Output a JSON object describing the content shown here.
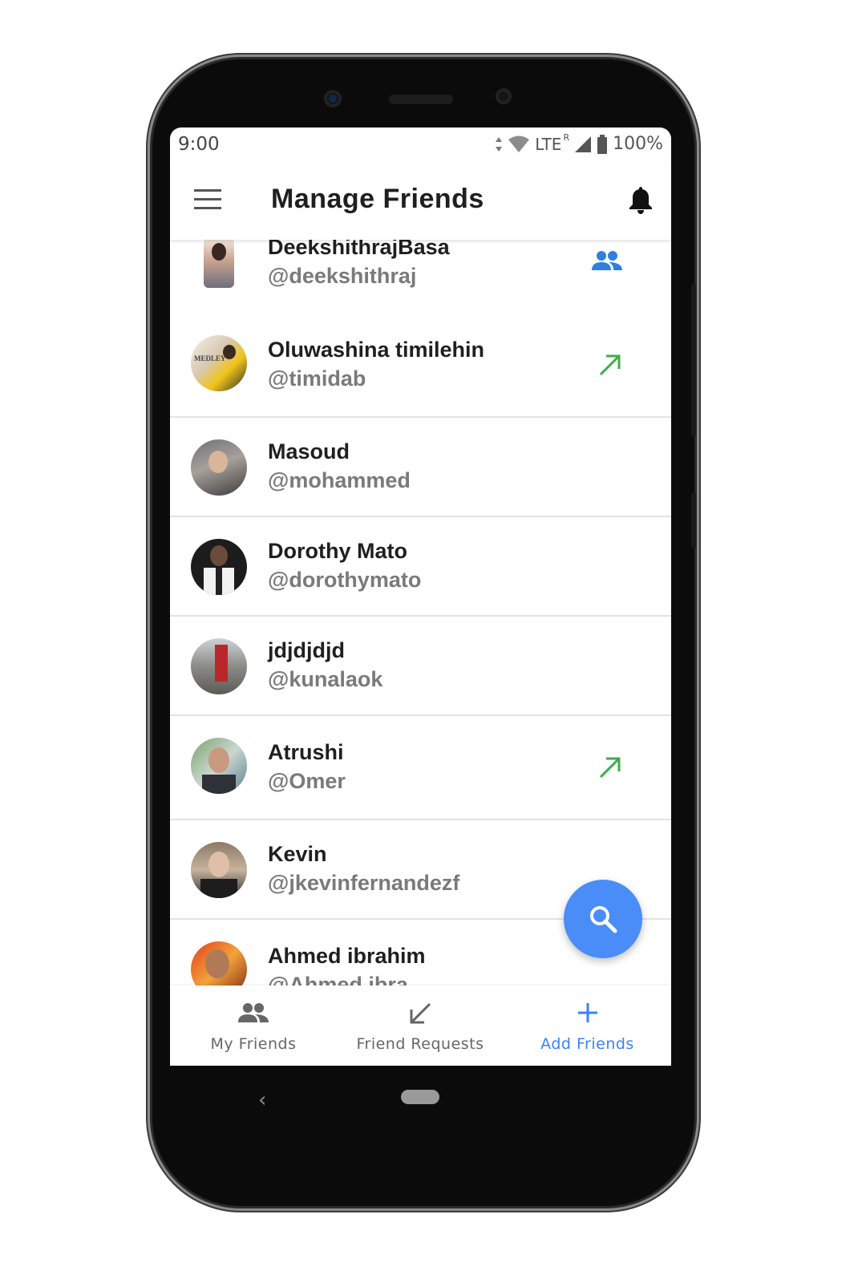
{
  "status_bar": {
    "time": "9:00",
    "network": "LTE",
    "roaming": "R",
    "battery": "100%"
  },
  "app_bar": {
    "title": "Manage Friends",
    "menu_icon": "menu-icon",
    "notification_icon": "bell-icon"
  },
  "friends": [
    {
      "name": "DeekshithrajBasa",
      "handle": "@deekshithraj",
      "action": "friends-icon"
    },
    {
      "name": "Oluwashina timilehin",
      "handle": "@timidab",
      "action": "arrow-up-right-icon"
    },
    {
      "name": "Masoud",
      "handle": "@mohammed",
      "action": ""
    },
    {
      "name": "Dorothy Mato",
      "handle": "@dorothymato",
      "action": ""
    },
    {
      "name": "jdjdjdjd",
      "handle": "@kunalaok",
      "action": ""
    },
    {
      "name": "Atrushi",
      "handle": "@Omer",
      "action": "arrow-up-right-icon"
    },
    {
      "name": "Kevin",
      "handle": "@jkevinfernandezf",
      "action": ""
    },
    {
      "name": "Ahmed ibrahim",
      "handle": "@Ahmed.ibra",
      "action": ""
    }
  ],
  "fab": {
    "icon": "search-icon"
  },
  "bottom_nav": {
    "items": [
      {
        "label": "My Friends",
        "icon": "people-icon",
        "active": false
      },
      {
        "label": "Friend Requests",
        "icon": "arrow-down-left-icon",
        "active": false
      },
      {
        "label": "Add Friends",
        "icon": "plus-icon",
        "active": true
      }
    ]
  },
  "colors": {
    "accent": "#3b82f6",
    "fab": "#4a8df8",
    "sent_arrow": "#3cae4a"
  }
}
